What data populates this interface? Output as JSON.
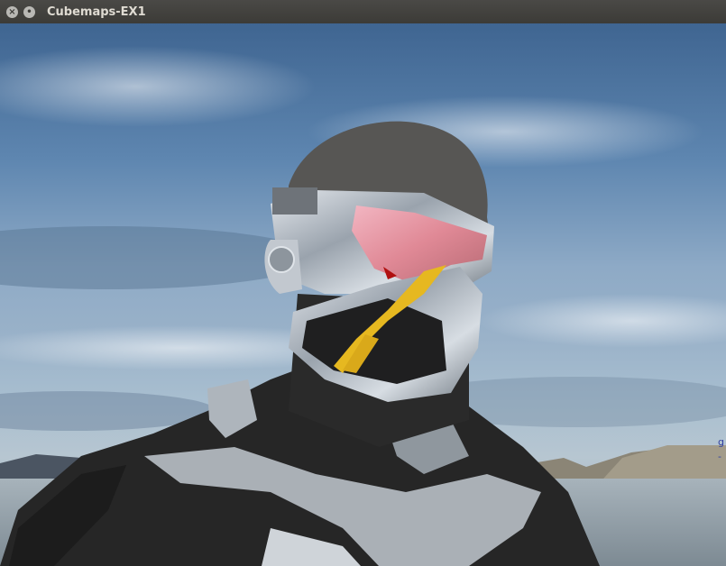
{
  "window": {
    "title": "Cubemaps-EX1",
    "controls": {
      "close_glyph": "×",
      "minimize_glyph": "•"
    }
  },
  "scene": {
    "description_icon": "armored-helmet-figure",
    "background_icon": "sky-cubemap",
    "side_marks": [
      "g",
      "-"
    ]
  },
  "colors": {
    "titlebar": "#3c3b37",
    "title_text": "#dfdbd2",
    "sky_top": "#3f6591",
    "visor": "#e79aa6",
    "accent_yellow": "#e6b820"
  }
}
